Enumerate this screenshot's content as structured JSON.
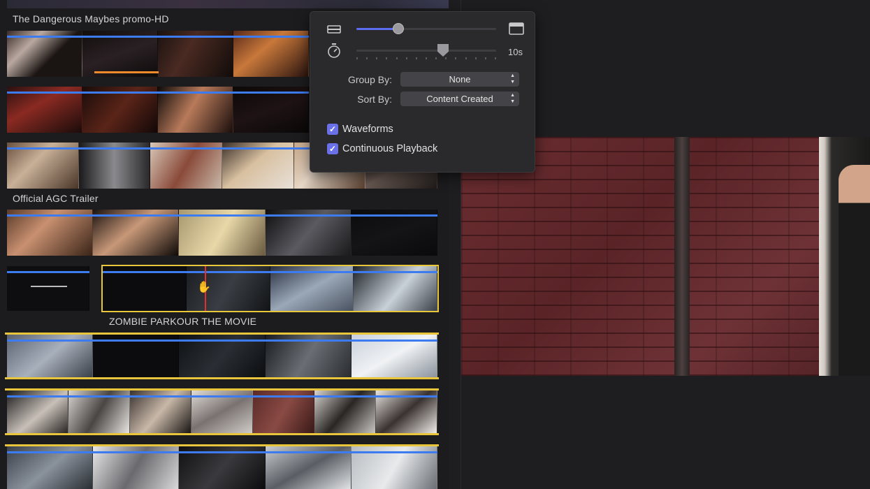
{
  "browser": {
    "groups": [
      {
        "title": "The Dangerous Maybes promo-HD"
      },
      {
        "title": "Official AGC Trailer"
      },
      {
        "title": "ZOMBIE PARKOUR THE MOVIE"
      }
    ]
  },
  "popover": {
    "clip_height_slider": {
      "value": 0.3
    },
    "duration_slider": {
      "value": 0.62,
      "label": "10s"
    },
    "group_by": {
      "label": "Group By:",
      "value": "None"
    },
    "sort_by": {
      "label": "Sort By:",
      "value": "Content Created"
    },
    "waveforms": {
      "label": "Waveforms",
      "checked": true
    },
    "continuous_playback": {
      "label": "Continuous Playback",
      "checked": true
    }
  },
  "icons": {
    "filmstrip_small": "filmstrip-small-icon",
    "filmstrip_large": "filmstrip-large-icon",
    "stopwatch": "stopwatch-icon",
    "checkmark": "checkmark-icon",
    "chevron": "updown-chevron-icon"
  },
  "colors": {
    "accent_blue": "#3d7bf0",
    "selection_yellow": "#e8c83a",
    "checkbox_purple": "#6a70e8",
    "playhead_red": "#e03030"
  }
}
